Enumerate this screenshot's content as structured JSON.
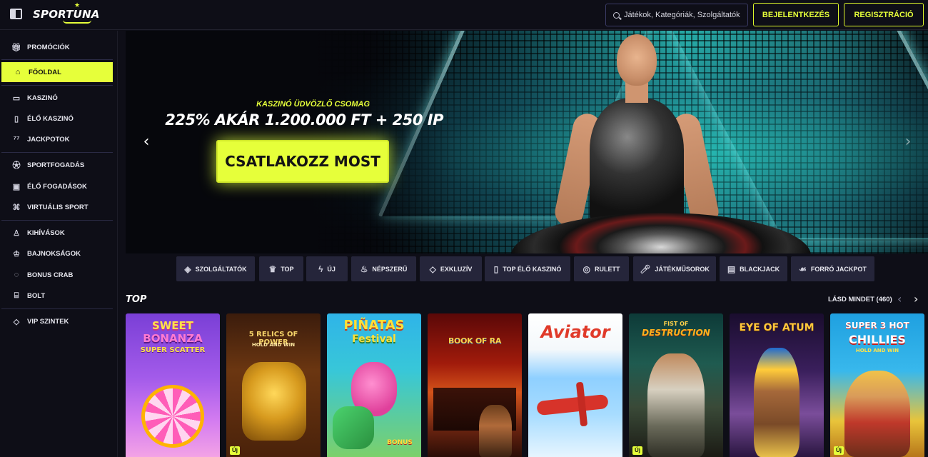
{
  "header": {
    "logo_text": "SPORTUNA",
    "search_placeholder": "Játékok, Kategóriák, Szolgáltatók",
    "login_label": "BEJELENTKEZÉS",
    "register_label": "REGISZTRÁCIÓ",
    "accent_color": "#e6ff3a"
  },
  "sidebar": {
    "items": [
      {
        "label": "PROMÓCIÓK",
        "icon": "gift-icon"
      },
      {
        "label": "FŐOLDAL",
        "icon": "home-icon",
        "active": true
      },
      {
        "label": "KASZINÓ",
        "icon": "cards-icon"
      },
      {
        "label": "ÉLŐ KASZINÓ",
        "icon": "phone-card-icon"
      },
      {
        "label": "JACKPOTOK",
        "icon": "number-seven-icon"
      },
      {
        "label": "SPORTFOGADÁS",
        "icon": "soccer-ball-icon"
      },
      {
        "label": "ÉLŐ FOGADÁSOK",
        "icon": "video-camera-icon"
      },
      {
        "label": "VIRTUÁLIS SPORT",
        "icon": "gamepad-icon"
      },
      {
        "label": "KIHÍVÁSOK",
        "icon": "medal-icon"
      },
      {
        "label": "BAJNOKSÁGOK",
        "icon": "trophy-icon"
      },
      {
        "label": "BONUS CRAB",
        "icon": "claw-icon"
      },
      {
        "label": "BOLT",
        "icon": "shopping-bag-icon"
      },
      {
        "label": "VIP SZINTEK",
        "icon": "diamond-icon"
      }
    ]
  },
  "hero": {
    "kicker": "KASZINÓ ÜDVÖZLŐ CSOMAG",
    "title": "225% AKÁR 1.200.000 FT + 250 IP",
    "cta_label": "CSATLAKOZZ MOST"
  },
  "categories": [
    {
      "label": "SZOLGÁLTATÓK",
      "icon": "layers-icon"
    },
    {
      "label": "TOP",
      "icon": "crown-icon"
    },
    {
      "label": "ÚJ",
      "icon": "lightning-icon"
    },
    {
      "label": "NÉPSZERŰ",
      "icon": "flame-icon"
    },
    {
      "label": "EXKLUZÍV",
      "icon": "diamond-icon"
    },
    {
      "label": "TOP ÉLŐ KASZINÓ",
      "icon": "phone-card-icon"
    },
    {
      "label": "RULETT",
      "icon": "roulette-icon"
    },
    {
      "label": "JÁTÉKMŰSOROK",
      "icon": "microphone-icon"
    },
    {
      "label": "BLACKJACK",
      "icon": "blackjack-icon"
    },
    {
      "label": "FORRÓ JACKPOT",
      "icon": "hot-pepper-icon"
    }
  ],
  "top_section": {
    "title": "TOP",
    "see_all_label": "LÁSD MINDET (460)"
  },
  "games": [
    {
      "title_line1": "SWEET",
      "title_line2": "BONANZA",
      "title_line3": "SUPER SCATTER",
      "badge": ""
    },
    {
      "title_line1": "5 RELICS OF POWER",
      "title_line2": "HOLD AND WIN",
      "title_line3": "",
      "badge": "Új"
    },
    {
      "title_line1": "PIÑATAS",
      "title_line2": "Festival",
      "title_line3": "BONUS",
      "badge": ""
    },
    {
      "title_line1": "BOOK OF RA",
      "title_line2": "",
      "title_line3": "",
      "badge": ""
    },
    {
      "title_line1": "Aviator",
      "title_line2": "",
      "title_line3": "",
      "badge": ""
    },
    {
      "title_line1": "FIST OF",
      "title_line2": "DESTRUCTION",
      "title_line3": "",
      "badge": "Új"
    },
    {
      "title_line1": "EYE OF ATUM",
      "title_line2": "",
      "title_line3": "",
      "badge": ""
    },
    {
      "title_line1": "SUPER 3 HOT",
      "title_line2": "CHILLIES",
      "title_line3": "HOLD AND WIN",
      "badge": "Új"
    }
  ]
}
